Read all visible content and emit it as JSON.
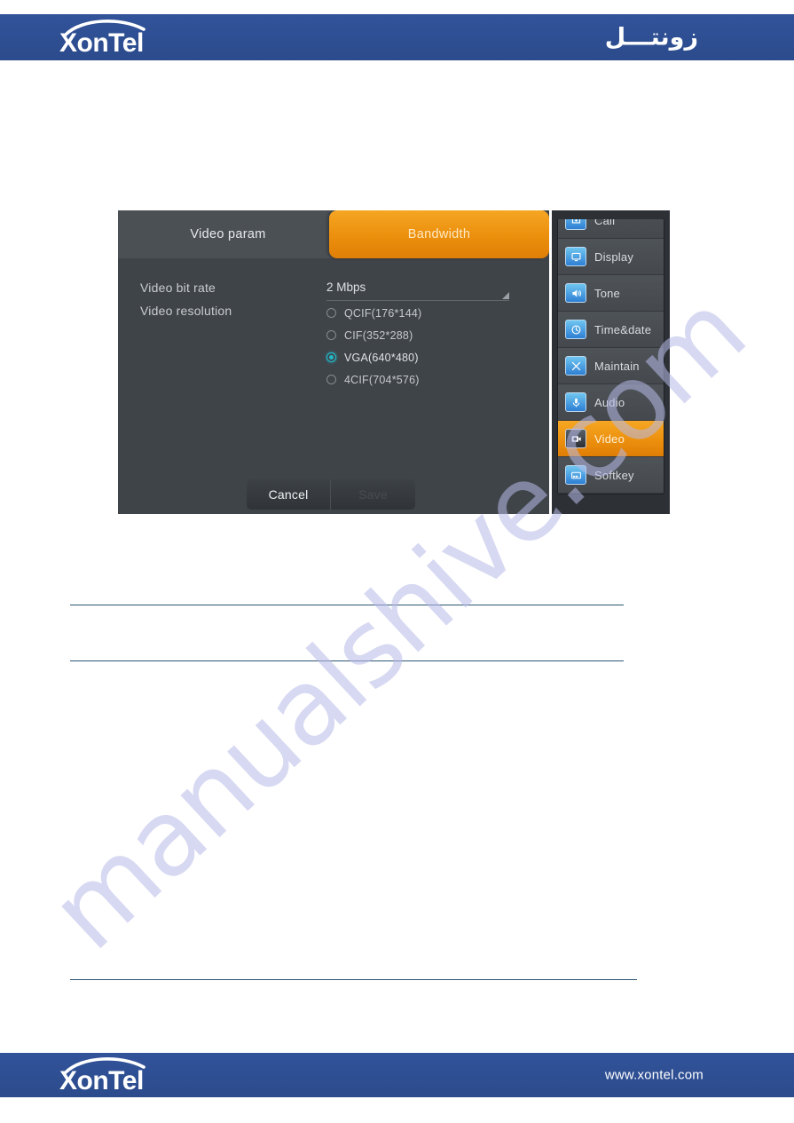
{
  "header": {
    "logo_text": "XonTel",
    "arabic_brand": "زونتـــل"
  },
  "footer": {
    "logo_text": "XonTel",
    "website": "www.xontel.com"
  },
  "watermark": {
    "text": "manualshive.com"
  },
  "screenshot": {
    "dialog": {
      "tabs": [
        {
          "label": "Video param",
          "active": false
        },
        {
          "label": "Bandwidth",
          "active": true
        }
      ],
      "fields": {
        "bitrate": {
          "label": "Video bit rate",
          "value": "2 Mbps"
        },
        "resolution": {
          "label": "Video resolution",
          "options": [
            {
              "label": "QCIF(176*144)",
              "selected": false
            },
            {
              "label": "CIF(352*288)",
              "selected": false
            },
            {
              "label": "VGA(640*480)",
              "selected": true
            },
            {
              "label": "4CIF(704*576)",
              "selected": false
            }
          ]
        }
      },
      "buttons": {
        "cancel": "Cancel",
        "save": "Save"
      }
    },
    "menu": {
      "items": [
        {
          "label": "Call",
          "icon": "call-icon",
          "active": false
        },
        {
          "label": "Display",
          "icon": "display-icon",
          "active": false
        },
        {
          "label": "Tone",
          "icon": "tone-icon",
          "active": false
        },
        {
          "label": "Time&date",
          "icon": "clock-icon",
          "active": false
        },
        {
          "label": "Maintain",
          "icon": "maintain-icon",
          "active": false
        },
        {
          "label": "Audio",
          "icon": "audio-icon",
          "active": false
        },
        {
          "label": "Video",
          "icon": "video-icon",
          "active": true
        },
        {
          "label": "Softkey",
          "icon": "softkey-icon",
          "active": false
        }
      ]
    }
  },
  "colors": {
    "brand_blue": "#2d4f92",
    "accent_orange": "#ec900e",
    "selected_radio": "#23b9c9",
    "rule": "#2f5574"
  }
}
